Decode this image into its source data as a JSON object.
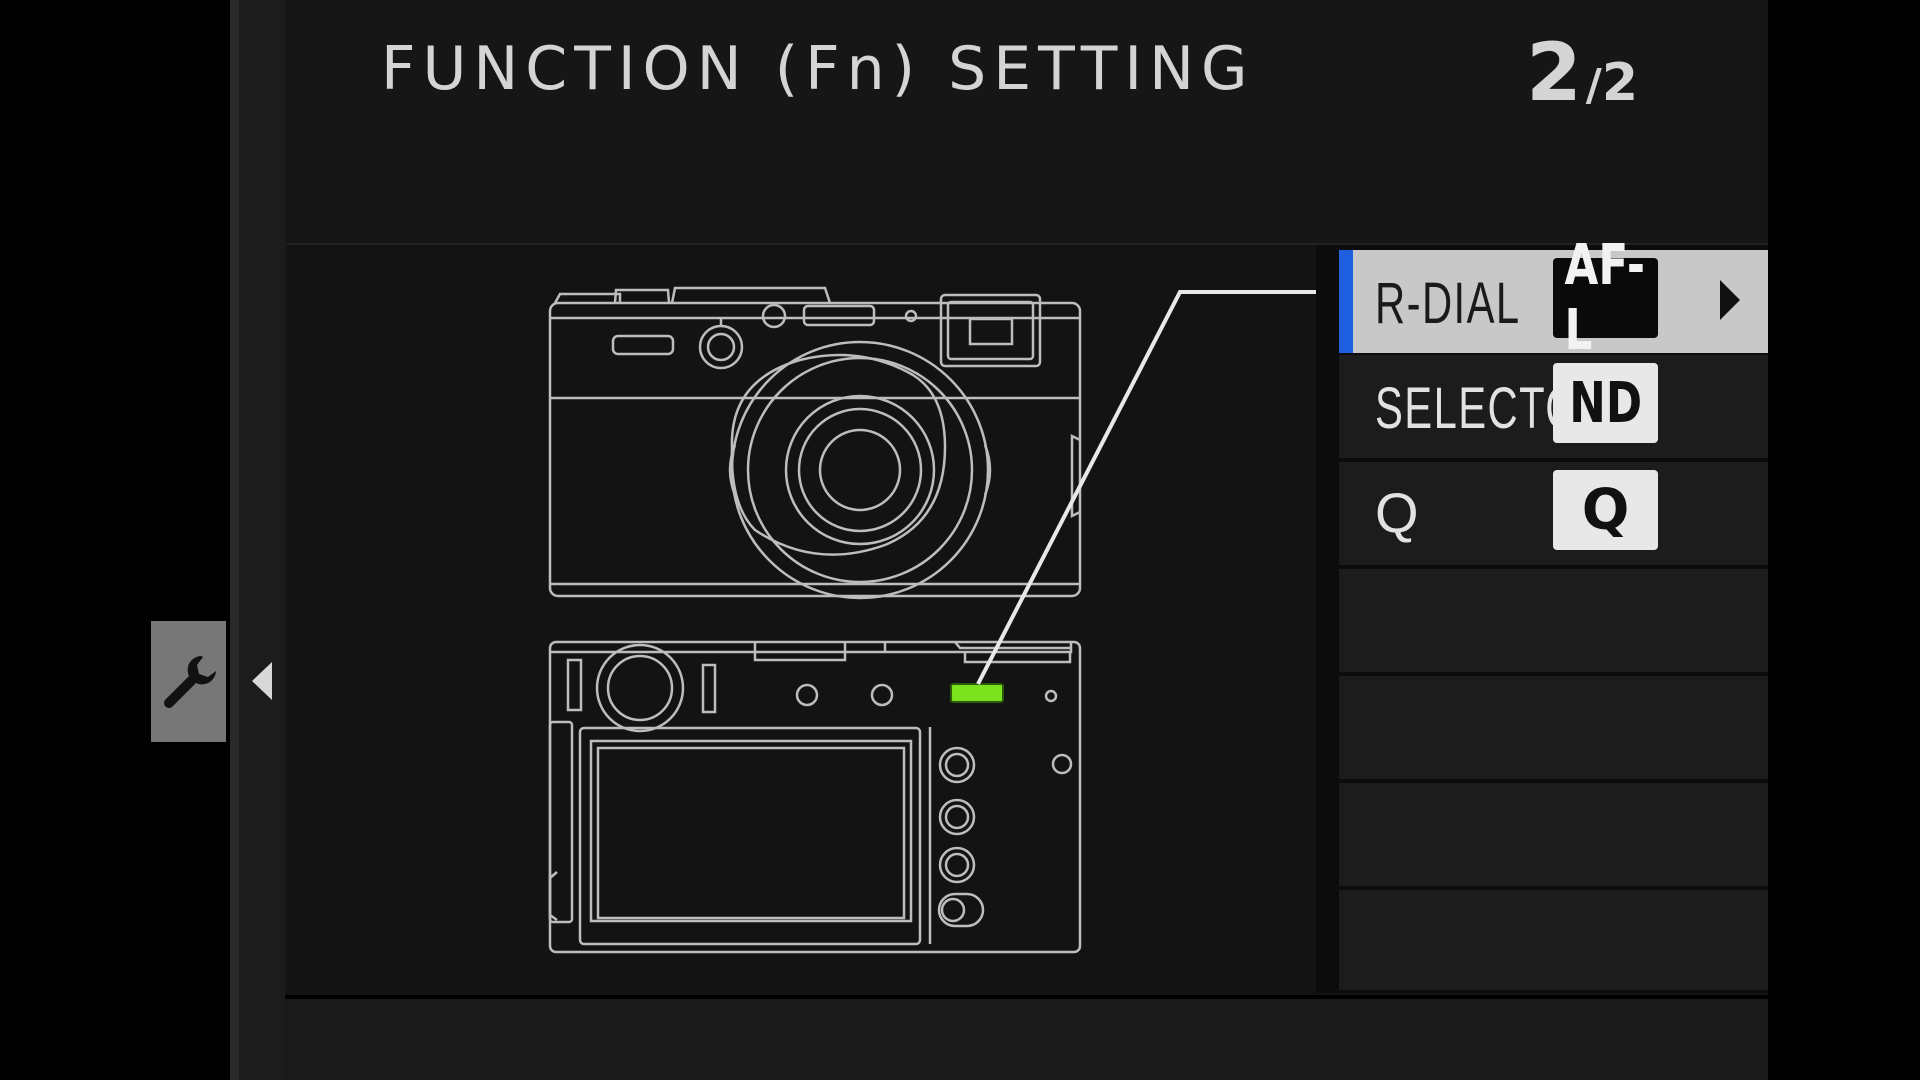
{
  "header": {
    "title": "FUNCTION (Fn) SETTING",
    "page_current": "2",
    "page_separator": "/",
    "page_total": "2"
  },
  "side_tab": {
    "icon": "wrench-icon",
    "arrow_icon": "triangle-left-icon"
  },
  "camera_illustration": {
    "highlighted_control": "R-DIAL",
    "highlight_color": "#7be21e"
  },
  "assignments": [
    {
      "label": "R-DIAL",
      "value": "AF-L",
      "selected": true
    },
    {
      "label": "SELECTOR",
      "value": "ND",
      "selected": false
    },
    {
      "label": "Q",
      "value": "Q",
      "selected": false
    },
    {
      "label": "",
      "value": "",
      "selected": false
    },
    {
      "label": "",
      "value": "",
      "selected": false
    },
    {
      "label": "",
      "value": "",
      "selected": false
    },
    {
      "label": "",
      "value": "",
      "selected": false
    }
  ],
  "colors": {
    "selection_bar": "#1e5fe0",
    "selected_row": "#c8c8c8",
    "row_background": "#1c1c1c",
    "text": "#d4d4d4"
  }
}
